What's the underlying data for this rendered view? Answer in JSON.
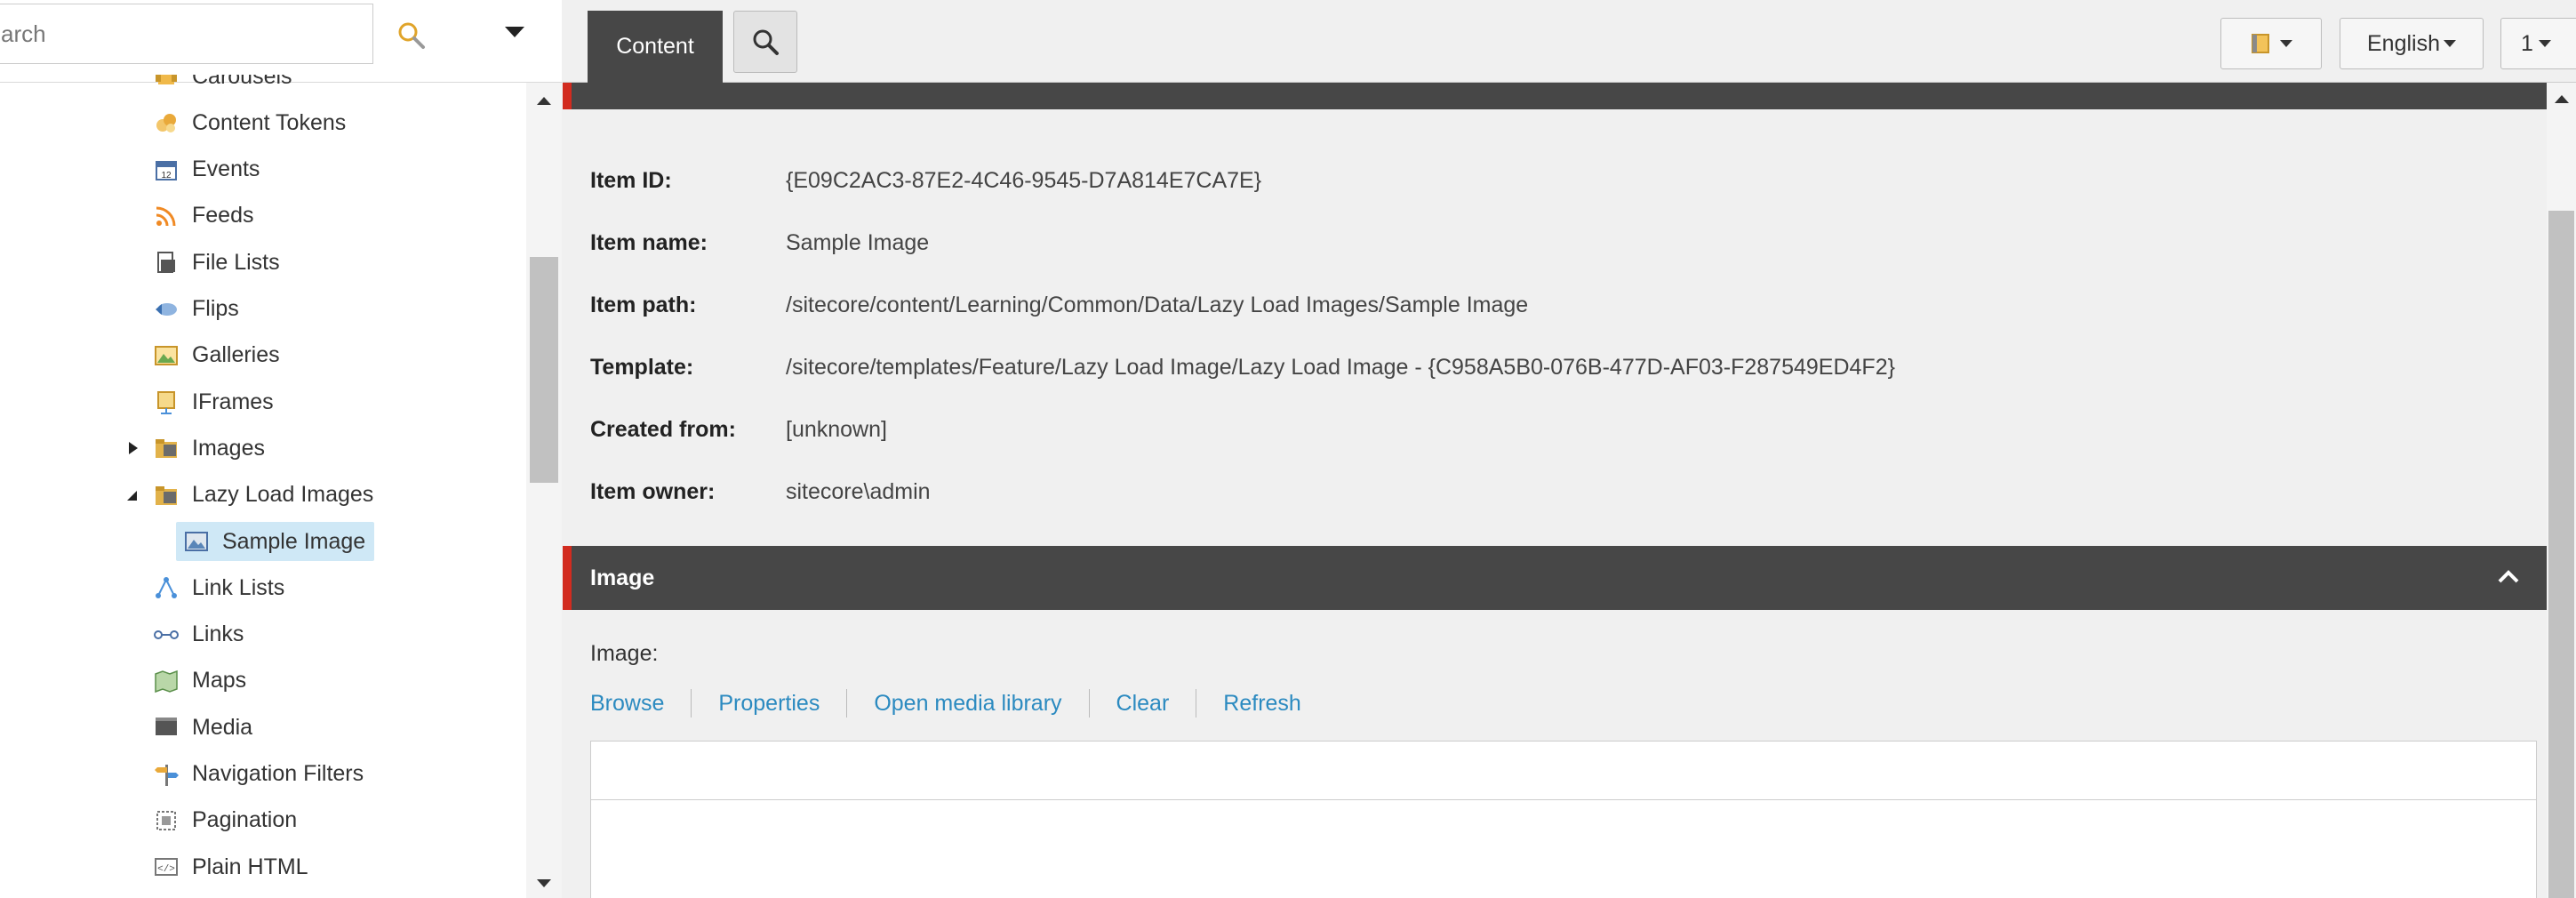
{
  "search": {
    "placeholder": "Search",
    "visible_placeholder": "arch"
  },
  "tree": {
    "items": [
      {
        "label": "Carousels",
        "icon": "carousel-icon"
      },
      {
        "label": "Content Tokens",
        "icon": "content-tokens-icon"
      },
      {
        "label": "Events",
        "icon": "calendar-icon"
      },
      {
        "label": "Feeds",
        "icon": "rss-feed-icon"
      },
      {
        "label": "File Lists",
        "icon": "file-list-icon"
      },
      {
        "label": "Flips",
        "icon": "flip-icon"
      },
      {
        "label": "Galleries",
        "icon": "gallery-icon"
      },
      {
        "label": "IFrames",
        "icon": "iframe-icon"
      },
      {
        "label": "Images",
        "icon": "folder-icon",
        "expander": "collapsed"
      },
      {
        "label": "Lazy Load Images",
        "icon": "folder-icon",
        "expander": "expanded"
      },
      {
        "label": "Sample Image",
        "icon": "image-icon",
        "selected": true
      },
      {
        "label": "Link Lists",
        "icon": "link-list-icon"
      },
      {
        "label": "Links",
        "icon": "links-icon"
      },
      {
        "label": "Maps",
        "icon": "map-icon"
      },
      {
        "label": "Media",
        "icon": "media-icon"
      },
      {
        "label": "Navigation Filters",
        "icon": "signpost-icon"
      },
      {
        "label": "Pagination",
        "icon": "pagination-icon"
      },
      {
        "label": "Plain HTML",
        "icon": "html-icon"
      }
    ]
  },
  "toolbar": {
    "tab_content": "Content",
    "language": "English",
    "version": "1"
  },
  "item_info": {
    "rows": [
      {
        "label": "Item ID:",
        "value": "{E09C2AC3-87E2-4C46-9545-D7A814E7CA7E}"
      },
      {
        "label": "Item name:",
        "value": "Sample Image"
      },
      {
        "label": "Item path:",
        "value": "/sitecore/content/Learning/Common/Data/Lazy Load Images/Sample Image"
      },
      {
        "label": "Template:",
        "value": "/sitecore/templates/Feature/Lazy Load Image/Lazy Load Image - {C958A5B0-076B-477D-AF03-F287549ED4F2}"
      },
      {
        "label": "Created from:",
        "value": "[unknown]"
      },
      {
        "label": "Item owner:",
        "value": "sitecore\\admin"
      }
    ]
  },
  "image_section": {
    "title": "Image",
    "field_label": "Image:",
    "links": [
      "Browse",
      "Properties",
      "Open media library",
      "Clear",
      "Refresh"
    ]
  },
  "colors": {
    "section_header": "#474747",
    "section_accent": "#d22b1f",
    "link": "#2b8ac0",
    "selected_bg": "#cfe8f6"
  }
}
